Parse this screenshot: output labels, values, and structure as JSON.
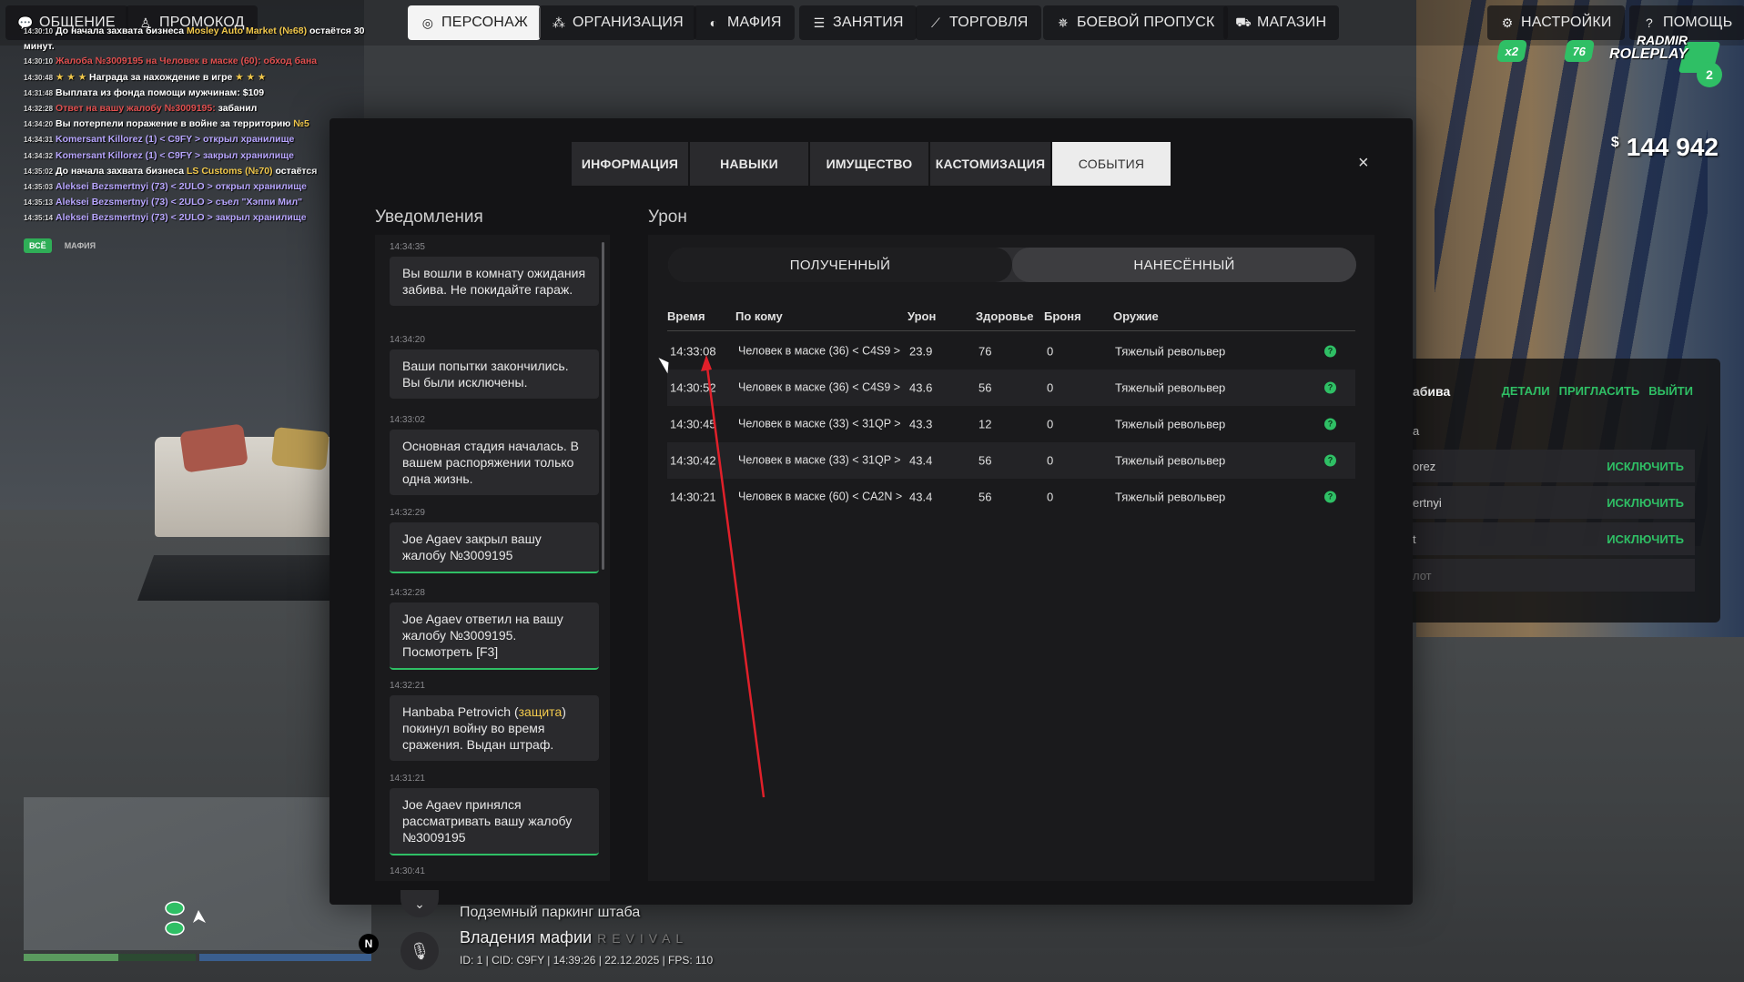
{
  "nav": {
    "left": [
      {
        "label": "ОБЩЕНИЕ",
        "icon": "chat-icon"
      },
      {
        "label": "ПРОМОКОД",
        "icon": "person-icon"
      },
      {
        "label": "ПЕРСОНАЖ",
        "icon": "user-icon",
        "active": true
      },
      {
        "label": "ОРГАНИЗАЦИЯ",
        "icon": "group-icon"
      },
      {
        "label": "МАФИЯ",
        "icon": "mask-icon"
      },
      {
        "label": "ЗАНЯТИЯ",
        "icon": "list-icon"
      },
      {
        "label": "ТОРГОВЛЯ",
        "icon": "chart-icon"
      },
      {
        "label": "БОЕВОЙ ПРОПУСК",
        "icon": "gear-star-icon"
      },
      {
        "label": "МАГАЗИН",
        "icon": "cart-icon"
      }
    ],
    "right": [
      {
        "label": "НАСТРОЙКИ",
        "icon": "gear-icon"
      },
      {
        "label": "ПОМОЩЬ",
        "icon": "help-icon"
      }
    ]
  },
  "chat": {
    "lines": [
      {
        "time": "14:30:10",
        "parts": [
          {
            "c": "w",
            "t": "До начала захвата бизнеса "
          },
          {
            "c": "y",
            "t": "Mosley Auto Market (№68)"
          },
          {
            "c": "w",
            "t": " остаётся 30"
          }
        ]
      },
      {
        "time": "",
        "parts": [
          {
            "c": "w",
            "t": "минут."
          }
        ]
      },
      {
        "time": "14:30:10",
        "parts": [
          {
            "c": "r",
            "t": "Жалоба №3009195 на Человек в маске (60): обход бана"
          }
        ]
      },
      {
        "time": "14:30:48",
        "parts": [
          {
            "c": "y",
            "t": "★ ★ ★ "
          },
          {
            "c": "w",
            "t": "Награда за нахождение в игре "
          },
          {
            "c": "y",
            "t": "★ ★ ★"
          }
        ]
      },
      {
        "time": "14:31:48",
        "parts": [
          {
            "c": "w",
            "t": "Выплата из фонда помощи мужчинам: $109"
          }
        ]
      },
      {
        "time": "14:32:28",
        "parts": [
          {
            "c": "r",
            "t": "Ответ на вашу жалобу №3009195: "
          },
          {
            "c": "w",
            "t": "забанил"
          }
        ]
      },
      {
        "time": "14:34:20",
        "parts": [
          {
            "c": "w",
            "t": "Вы потерпели поражение в войне за территорию "
          },
          {
            "c": "y",
            "t": "№5"
          }
        ]
      },
      {
        "time": "14:34:31",
        "parts": [
          {
            "c": "p",
            "t": "Komersant Killorez (1) < C9FY > открыл хранилище"
          }
        ]
      },
      {
        "time": "14:34:32",
        "parts": [
          {
            "c": "p",
            "t": "Komersant Killorez (1) < C9FY > закрыл хранилище"
          }
        ]
      },
      {
        "time": "14:35:02",
        "parts": [
          {
            "c": "w",
            "t": "До начала захвата бизнеса "
          },
          {
            "c": "y",
            "t": "LS Customs (№70)"
          },
          {
            "c": "w",
            "t": " остаётся"
          }
        ]
      },
      {
        "time": "14:35:03",
        "parts": [
          {
            "c": "p",
            "t": "Aleksei Bezsmertnyi (73) < 2ULO > открыл хранилище"
          }
        ]
      },
      {
        "time": "14:35:13",
        "parts": [
          {
            "c": "p",
            "t": "Aleksei Bezsmertnyi (73) < 2ULO > съел \"Хэппи Мил\""
          }
        ]
      },
      {
        "time": "14:35:14",
        "parts": [
          {
            "c": "p",
            "t": "Aleksei Bezsmertnyi (73) < 2ULO > закрыл хранилище"
          }
        ]
      }
    ],
    "tabs": [
      {
        "label": "ВСЁ",
        "active": true
      },
      {
        "label": "МАФИЯ"
      }
    ]
  },
  "hud": {
    "money_currency": "$",
    "money": "144 942",
    "logo_top": "RADMIR",
    "logo_bottom": "ROLEPLAY",
    "badge_a": "x2",
    "badge_b": "76",
    "badge_c": "2"
  },
  "family": {
    "title": "абива",
    "actions": [
      "ДЕТАЛИ",
      "ПРИГЛАСИТЬ",
      "ВЫЙТИ"
    ],
    "subtitle": "а",
    "members": [
      {
        "name": "orez",
        "action": "ИСКЛЮЧИТЬ"
      },
      {
        "name": "ertnyi",
        "action": "ИСКЛЮЧИТЬ"
      },
      {
        "name": "t",
        "action": "ИСКЛЮЧИТЬ"
      },
      {
        "name": "лот",
        "action": ""
      }
    ]
  },
  "modal": {
    "tabs": [
      {
        "label": "ИНФОРМАЦИЯ"
      },
      {
        "label": "НАВЫКИ"
      },
      {
        "label": "ИМУЩЕСТВО"
      },
      {
        "label": "КАСТОМИЗАЦИЯ"
      },
      {
        "label": "СОБЫТИЯ",
        "active": true
      }
    ],
    "close": "×",
    "notifications_title": "Уведомления",
    "damage_title": "Урон",
    "notifications": [
      {
        "time": "14:34:35",
        "parts": [
          {
            "t": "Вы вошли в комнату ожидания забива. Не покидайте гараж."
          }
        ],
        "green": false
      },
      {
        "time": "14:34:20",
        "parts": [
          {
            "t": "Ваши попытки закончились. Вы были исключены."
          }
        ],
        "green": false
      },
      {
        "time": "14:33:02",
        "parts": [
          {
            "t": "Основная стадия началась. В вашем распоряжении только одна жизнь."
          }
        ],
        "green": false
      },
      {
        "time": "14:32:29",
        "parts": [
          {
            "t": "Joe Agaev закрыл вашу жалобу №3009195"
          }
        ],
        "green": true
      },
      {
        "time": "14:32:28",
        "parts": [
          {
            "t": "Joe Agaev ответил на вашу жалобу №3009195. Посмотреть [F3]"
          }
        ],
        "green": true
      },
      {
        "time": "14:32:21",
        "parts": [
          {
            "t": "Hanbaba Petrovich ("
          },
          {
            "t": "защита",
            "hl": true
          },
          {
            "t": ") покинул войну во время сражения. Выдан штраф."
          }
        ],
        "green": false
      },
      {
        "time": "14:31:21",
        "parts": [
          {
            "t": "Joe Agaev принялся рассматривать вашу жалобу №3009195"
          }
        ],
        "green": true
      },
      {
        "time": "14:30:41",
        "parts": [
          {
            "t": ""
          }
        ],
        "green": false
      }
    ],
    "damage_tabs": [
      {
        "label": "ПОЛУЧЕННЫЙ",
        "active": true
      },
      {
        "label": "НАНЕСЁННЫЙ"
      }
    ],
    "table": {
      "headers": [
        "Время",
        "По кому",
        "Урон",
        "Здоровье",
        "Броня",
        "Оружие"
      ],
      "rows": [
        {
          "time": "14:33:08",
          "who": "Человек в маске (36) < C4S9 >",
          "damage": "23.9",
          "health": "76",
          "armor": "0",
          "weapon": "Тяжелый револьвер"
        },
        {
          "time": "14:30:52",
          "who": "Человек в маске (36) < C4S9 >",
          "damage": "43.6",
          "health": "56",
          "armor": "0",
          "weapon": "Тяжелый револьвер"
        },
        {
          "time": "14:30:45",
          "who": "Человек в маске (33) < 31QP >",
          "damage": "43.3",
          "health": "12",
          "armor": "0",
          "weapon": "Тяжелый револьвер"
        },
        {
          "time": "14:30:42",
          "who": "Человек в маске (33) < 31QP >",
          "damage": "43.4",
          "health": "56",
          "armor": "0",
          "weapon": "Тяжелый револьвер"
        },
        {
          "time": "14:30:21",
          "who": "Человек в маске (60) < CA2N >",
          "damage": "43.4",
          "health": "56",
          "armor": "0",
          "weapon": "Тяжелый револьвер"
        }
      ]
    }
  },
  "bottom": {
    "location": "Подземный паркинг штаба",
    "zone": "Владения мафии",
    "zone_suffix": "REVIVAL",
    "stats": "ID: 1 | CID: C9FY | 14:39:26  | 22.12.2025 | FPS: 110",
    "compass": "N"
  },
  "colors": {
    "accent": "#2fbf65",
    "panel": "#141416",
    "highlight": "#f2c94c",
    "annotation": "#e0202a"
  }
}
